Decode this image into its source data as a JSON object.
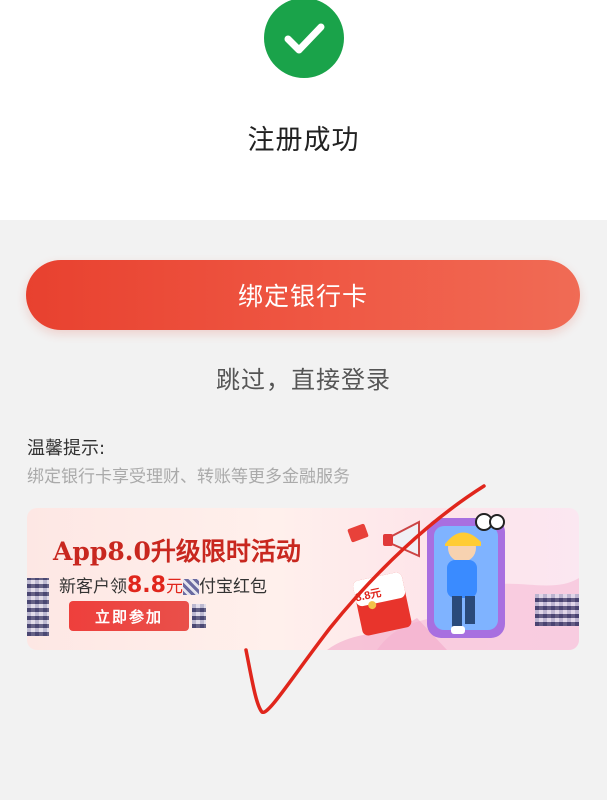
{
  "success": {
    "icon": "check-icon",
    "title": "注册成功",
    "color": "#1aa34a"
  },
  "actions": {
    "bind_card_label": "绑定银行卡",
    "skip_label": "跳过，直接登录"
  },
  "tips": {
    "title": "温馨提示:",
    "text": "绑定银行卡享受理财、转账等更多金融服务"
  },
  "banner": {
    "title": "App8.0升级限时活动",
    "subtitle_prefix": "新客户领",
    "amount": "8.8",
    "unit": "元",
    "subtitle_suffix": "付宝红包",
    "join_label": "立即参加",
    "envelope_label": "8.8元"
  },
  "colors": {
    "accent": "#e8412f",
    "annotation": "#e0261c"
  }
}
